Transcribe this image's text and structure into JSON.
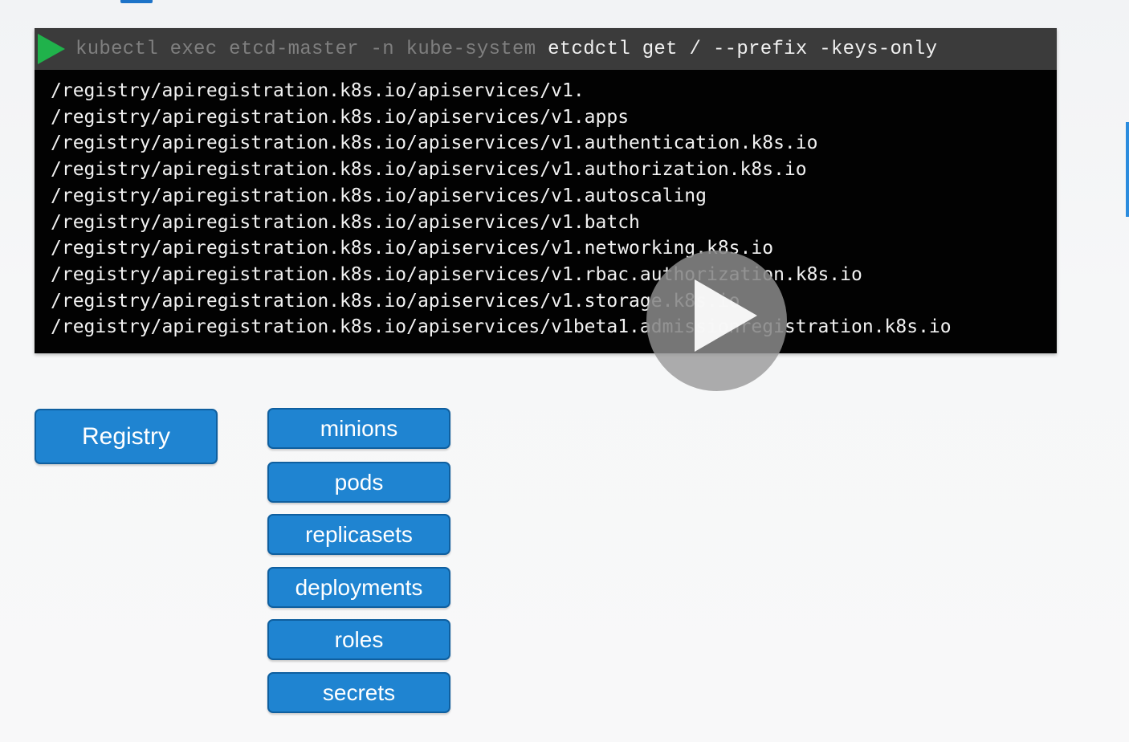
{
  "terminal": {
    "command_dim": "kubectl exec etcd-master -n kube-system",
    "command_bright": " etcdctl get / --prefix -keys-only",
    "output_lines": [
      "/registry/apiregistration.k8s.io/apiservices/v1.",
      "/registry/apiregistration.k8s.io/apiservices/v1.apps",
      "/registry/apiregistration.k8s.io/apiservices/v1.authentication.k8s.io",
      "/registry/apiregistration.k8s.io/apiservices/v1.authorization.k8s.io",
      "/registry/apiregistration.k8s.io/apiservices/v1.autoscaling",
      "/registry/apiregistration.k8s.io/apiservices/v1.batch",
      "/registry/apiregistration.k8s.io/apiservices/v1.networking.k8s.io",
      "/registry/apiregistration.k8s.io/apiservices/v1.rbac.authorization.k8s.io",
      "/registry/apiregistration.k8s.io/apiservices/v1.storage.k8s.io",
      "/registry/apiregistration.k8s.io/apiservices/v1beta1.admissionregistration.k8s.io"
    ]
  },
  "diagram": {
    "root": "Registry",
    "resources": [
      "minions",
      "pods",
      "replicasets",
      "deployments",
      "roles",
      "secrets"
    ]
  },
  "colors": {
    "accent": "#1f84d1",
    "terminal_background": "#020202",
    "prompt_icon": "#20b24b"
  },
  "icons": {
    "prompt": "play-triangle-icon",
    "video_play": "play-icon"
  }
}
